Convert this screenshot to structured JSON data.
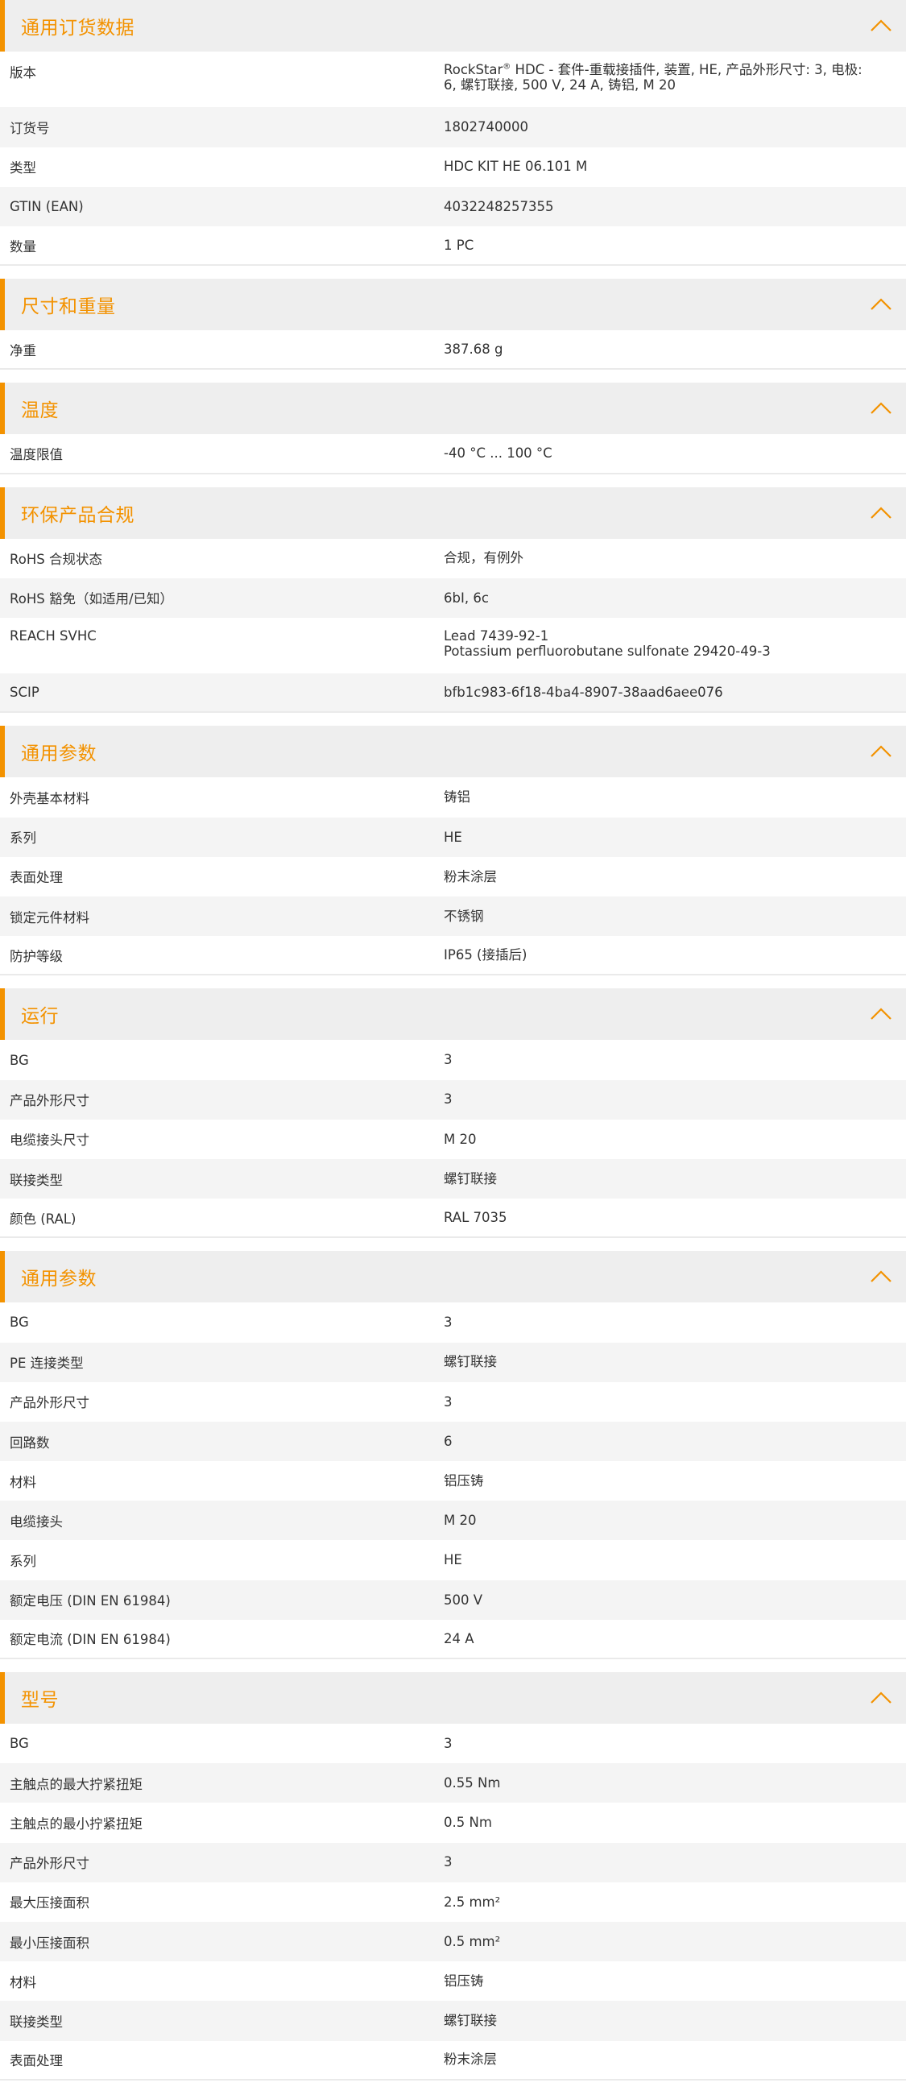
{
  "theme": {
    "accent": "#f39200",
    "header_bg": "#eeeeee",
    "alt_row_bg": "#f4f4f4"
  },
  "sections": [
    {
      "title": "通用订货数据",
      "rows": [
        {
          "label": "版本",
          "value": "RockStar® HDC - 套件-重载接插件, 装置, HE, 产品外形尺寸: 3, 电极: 6, 螺钉联接, 500 V, 24 A, 铸铝, M 20"
        },
        {
          "label": "订货号",
          "value": "1802740000"
        },
        {
          "label": "类型",
          "value": "HDC KIT HE 06.101 M"
        },
        {
          "label": "GTIN (EAN)",
          "value": "4032248257355"
        },
        {
          "label": "数量",
          "value": "1  PC"
        }
      ]
    },
    {
      "title": "尺寸和重量",
      "rows": [
        {
          "label": "净重",
          "value": "387.68  g"
        }
      ]
    },
    {
      "title": "温度",
      "rows": [
        {
          "label": "温度限值",
          "value": "-40 °C ... 100 °C"
        }
      ]
    },
    {
      "title": "环保产品合规",
      "rows": [
        {
          "label": "RoHS 合规状态",
          "value": "合规，有例外"
        },
        {
          "label": "RoHS 豁免（如适用/已知）",
          "value": "6bI, 6c"
        },
        {
          "label": "REACH SVHC",
          "value": "Lead 7439-92-1\nPotassium perfluorobutane sulfonate 29420-49-3"
        },
        {
          "label": "SCIP",
          "value": "bfb1c983-6f18-4ba4-8907-38aad6aee076"
        }
      ]
    },
    {
      "title": "通用参数",
      "rows": [
        {
          "label": "外壳基本材料",
          "value": "铸铝"
        },
        {
          "label": "系列",
          "value": "HE"
        },
        {
          "label": "表面处理",
          "value": "粉末涂层"
        },
        {
          "label": "锁定元件材料",
          "value": "不锈钢"
        },
        {
          "label": "防护等级",
          "value": "IP65 (接插后)"
        }
      ]
    },
    {
      "title": "运行",
      "rows": [
        {
          "label": "BG",
          "value": "3"
        },
        {
          "label": "产品外形尺寸",
          "value": "3"
        },
        {
          "label": "电缆接头尺寸",
          "value": "M 20"
        },
        {
          "label": "联接类型",
          "value": "螺钉联接"
        },
        {
          "label": "颜色 (RAL)",
          "value": "RAL 7035"
        }
      ]
    },
    {
      "title": "通用参数",
      "rows": [
        {
          "label": "BG",
          "value": "3"
        },
        {
          "label": "PE 连接类型",
          "value": "螺钉联接"
        },
        {
          "label": "产品外形尺寸",
          "value": "3"
        },
        {
          "label": "回路数",
          "value": "6"
        },
        {
          "label": "材料",
          "value": "铝压铸"
        },
        {
          "label": "电缆接头",
          "value": "M 20"
        },
        {
          "label": "系列",
          "value": "HE"
        },
        {
          "label": "额定电压 (DIN EN 61984)",
          "value": "500  V"
        },
        {
          "label": "额定电流 (DIN EN 61984)",
          "value": "24  A"
        }
      ]
    },
    {
      "title": "型号",
      "rows": [
        {
          "label": "BG",
          "value": "3"
        },
        {
          "label": "主触点的最大拧紧扭矩",
          "value": "0.55  Nm"
        },
        {
          "label": "主触点的最小拧紧扭矩",
          "value": "0.5  Nm"
        },
        {
          "label": "产品外形尺寸",
          "value": "3"
        },
        {
          "label": "最大压接面积",
          "value": "2.5  mm²"
        },
        {
          "label": "最小压接面积",
          "value": "0.5  mm²"
        },
        {
          "label": "材料",
          "value": "铝压铸"
        },
        {
          "label": "联接类型",
          "value": "螺钉联接"
        },
        {
          "label": "表面处理",
          "value": "粉末涂层"
        }
      ]
    }
  ]
}
